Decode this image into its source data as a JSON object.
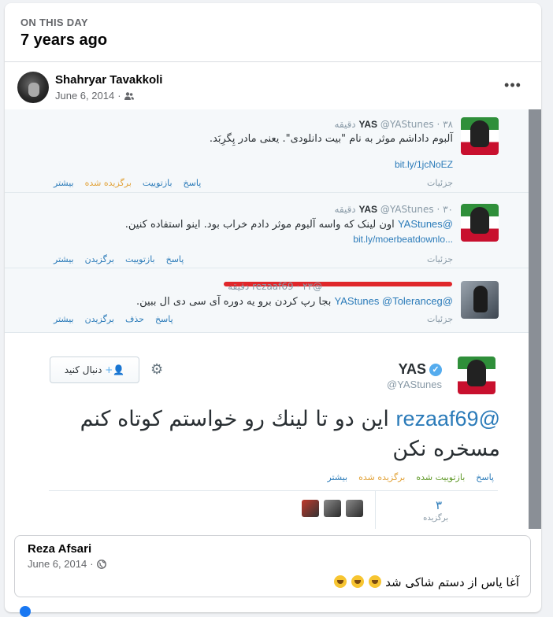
{
  "memory": {
    "label": "ON THIS DAY",
    "title": "7 years ago"
  },
  "post": {
    "author": "Shahryar Tavakkoli",
    "date": "June 6, 2014",
    "audience_icon": "friends-icon",
    "more_icon": "more-options-icon",
    "more_label": "•••"
  },
  "tweets": [
    {
      "name": "YAS",
      "handle": "@YAStunes",
      "time": "۳۸ دقیقه",
      "text": "آلبوم داداشم موثر به نام \"بیت دانلودی\". یعنی مادر پِگرِبَد.",
      "link": "bit.ly/1jcNoEZ",
      "details": "جزئیات",
      "actions": [
        "پاسخ",
        "بازتوییت",
        "برگزیده شده",
        "بیشتر"
      ]
    },
    {
      "name": "YAS",
      "handle": "@YAStunes",
      "time": "۳۰ دقیقه",
      "mention": "@YAStunes",
      "text": "اون لینک که واسه آلبوم موثر دادم خراب بود. اینو استفاده کنین.",
      "link": "bit.ly/moerbeatdownlo...",
      "details": "جزئیات",
      "actions": [
        "پاسخ",
        "بازتوییت",
        "برگزیدن",
        "بیشتر"
      ]
    },
    {
      "handle": "@rezaaf69",
      "time": "۲۳ دقیقه",
      "mention": "@YAStunes @Toleranceg",
      "text": "بجا رپ کردن برو یه دوره آی سی دی ال ببین.",
      "details": "جزئیات",
      "actions": [
        "پاسخ",
        "حذف",
        "برگزیدن",
        "بیشتر"
      ]
    }
  ],
  "expanded_tweet": {
    "name": "YAS",
    "handle": "@YAStunes",
    "follow_label": "دنبال کنید",
    "mention": "@rezaaf69",
    "text": "این دو تا لینك رو خواستم كوتاه كنم مسخره نكن",
    "actions": [
      "پاسخ",
      "بازتوییت شده",
      "برگزیده شده",
      "بیشتر"
    ],
    "fav_count": "۳",
    "fav_label": "برگزیده"
  },
  "comment": {
    "author": "Reza Afsari",
    "date": "June 6, 2014",
    "privacy_icon": "globe-icon",
    "text": "آغا یاس از دستم شاکی شد"
  },
  "colors": {
    "twitter_blue": "#2b7bb9",
    "favorite_gold": "#e2a33a",
    "facebook_gray": "#65676b"
  }
}
